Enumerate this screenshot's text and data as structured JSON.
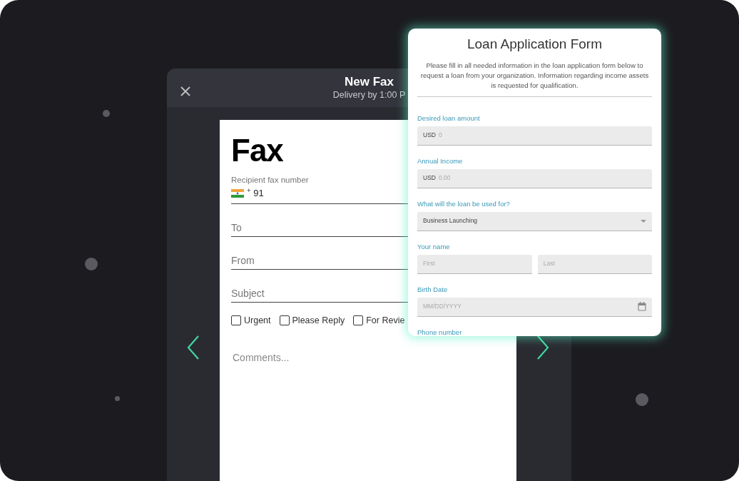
{
  "fax": {
    "title": "New Fax",
    "subtitle": "Delivery by 1:00 P",
    "heading": "Fax",
    "recipient_label": "Recipient fax number",
    "country_code": "$^{+}$ 91",
    "fields": [
      {
        "placeholder": "To"
      },
      {
        "placeholder": "From"
      },
      {
        "placeholder": "Subject"
      }
    ],
    "checkboxes": [
      {
        "label": "Urgent",
        "checked": false
      },
      {
        "label": "Please Reply",
        "checked": false
      },
      {
        "label": "For Revie",
        "checked": false
      }
    ],
    "comments_placeholder": "Comments..."
  },
  "loan_form": {
    "title": "Loan Application Form",
    "description": "Please fill in all needed information in the loan application form below to request a loan from your organization. Information regarding income assets is requested for qualification.",
    "fields": [
      {
        "kind": "prefixed",
        "label": "Desired loan amount",
        "prefix": "USD",
        "placeholder": "0"
      },
      {
        "kind": "prefixed",
        "label": "Annual Income",
        "prefix": "USD",
        "placeholder": "0.00"
      },
      {
        "kind": "select",
        "label": "What will the loan be used for?",
        "value": "Business Launching"
      },
      {
        "kind": "name",
        "label": "Your name",
        "placeholders": [
          "First",
          "Last"
        ]
      },
      {
        "kind": "date",
        "label": "Birth Date",
        "placeholder": "MM/DD/YYYY"
      },
      {
        "kind": "label",
        "label": "Phone number"
      }
    ]
  }
}
